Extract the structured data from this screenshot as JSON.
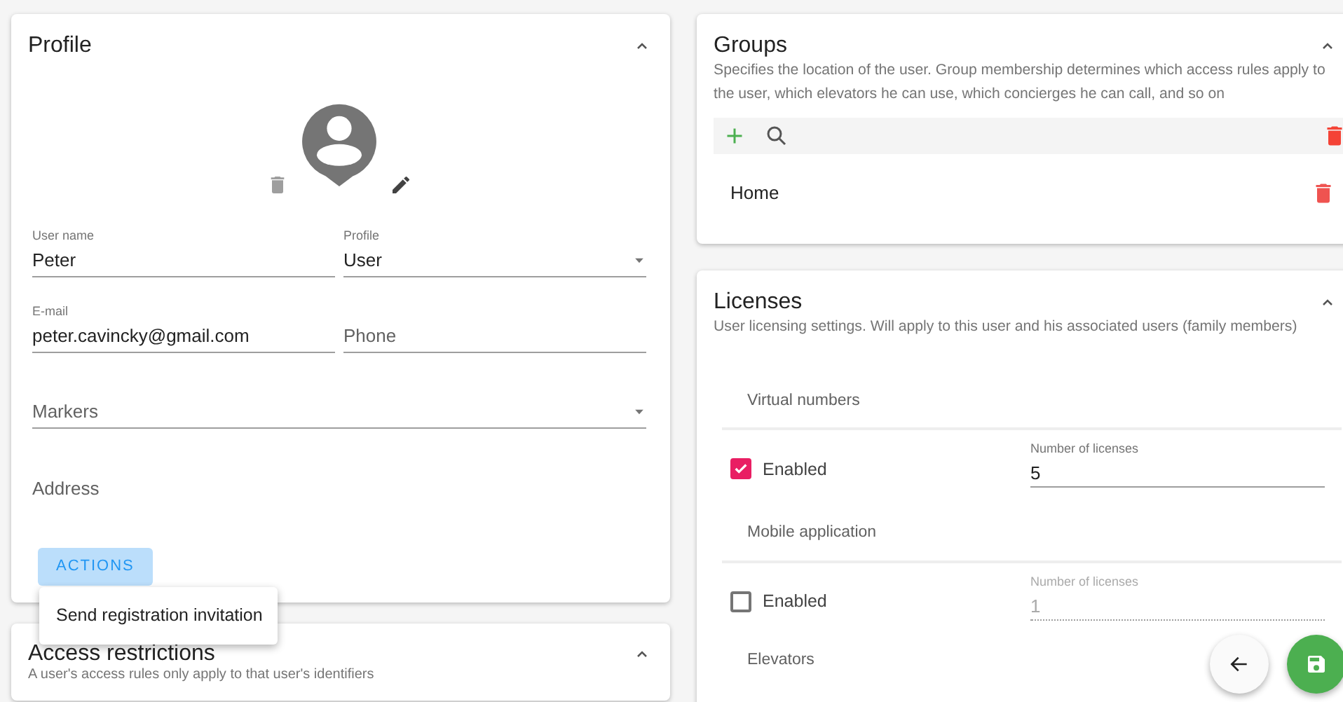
{
  "profile": {
    "title": "Profile",
    "expanded": true,
    "fields": [
      {
        "kind": "text",
        "label": "User name",
        "value": "Peter"
      },
      {
        "kind": "select",
        "label": "Profile",
        "value": "User"
      },
      {
        "kind": "text",
        "label": "E-mail",
        "value": "peter.cavincky@gmail.com"
      },
      {
        "kind": "text",
        "placeholder": "Phone"
      },
      {
        "kind": "select",
        "placeholder": "Markers",
        "wide": true
      },
      {
        "kind": "area",
        "placeholder": "Address",
        "wide": true
      }
    ],
    "actions_button": "ACTIONS",
    "actions_menu": [
      "Send registration invitation"
    ]
  },
  "access_restrictions": {
    "title": "Access restrictions",
    "expanded": true,
    "description": "A user's access rules only apply to that user's identifiers"
  },
  "groups": {
    "title": "Groups",
    "expanded": true,
    "description": "Specifies the location of the user. Group membership determines which access rules apply to the user, which elevators he can use, which concierges he can call, and so on",
    "items": [
      {
        "name": "Home"
      }
    ]
  },
  "licenses": {
    "title": "Licenses",
    "expanded": true,
    "description": "User licensing settings. Will apply to this user and his associated users (family members)",
    "sections": [
      {
        "name": "Virtual numbers",
        "checkbox_label": "Enabled",
        "enabled": true,
        "count_label": "Number of licenses",
        "count": "5"
      },
      {
        "name": "Mobile application",
        "checkbox_label": "Enabled",
        "enabled": false,
        "count_label": "Number of licenses",
        "count": "1"
      },
      {
        "name": "Elevators"
      }
    ]
  }
}
